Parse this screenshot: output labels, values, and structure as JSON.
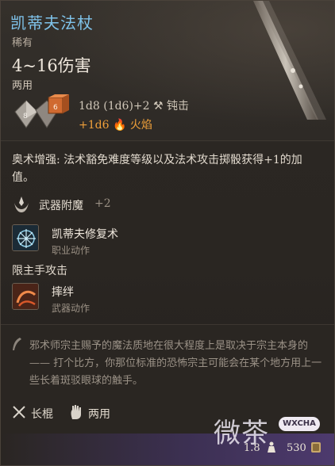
{
  "item": {
    "name": "凯蒂夫法杖",
    "rarity": "稀有",
    "damage": "4~16伤害",
    "handedness": "两用",
    "dice_a": "8",
    "dice_b": "6",
    "damage_line1": "1d8 (1d6)+2",
    "damage_type1": "钝击",
    "damage_line2": "+1d6",
    "damage_type2": "火焰"
  },
  "arcane_text": "奥术增强: 法术豁免难度等级以及法术攻击掷骰获得+1的加值。",
  "enchant": {
    "label": "武器附魔",
    "value": "+2"
  },
  "actions": [
    {
      "name": "凯蒂夫修复术",
      "type": "职业动作"
    },
    {
      "name": "摔绊",
      "type": "武器动作"
    }
  ],
  "mainhand_label": "限主手攻击",
  "lore": "邪术师宗主赐予的魔法质地在很大程度上是取决于宗主本身的 —— 打个比方，你那位标准的恐怖宗主可能会在某个地方用上一些长着斑驳眼球的触手。",
  "proficiency": {
    "weapon": "长棍",
    "hands": "两用"
  },
  "footer": {
    "weight": "1.8",
    "price": "530"
  },
  "watermark": {
    "text": "微茶",
    "badge": "WXCHA"
  },
  "colors": {
    "title": "#7fc3ea",
    "fire": "#f0a03a",
    "accent_purple": "#4d3a6e"
  }
}
